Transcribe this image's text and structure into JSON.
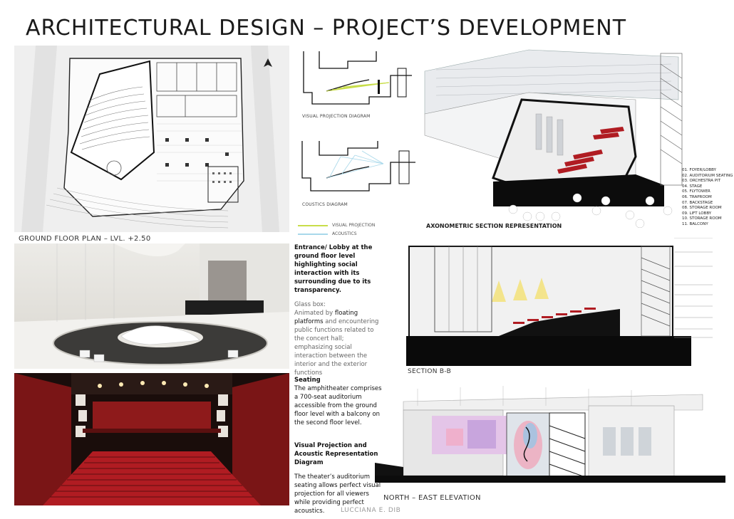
{
  "title": "ARCHITECTURAL DESIGN – PROJECT’S DEVELOPMENT",
  "plan": {
    "caption": "GROUND FLOOR PLAN – LVL. +2.50"
  },
  "diagrams": {
    "visual_caption": "VISUAL PROJECTION DIAGRAM",
    "acoustics_caption": "COUSTICS DIAGRAM",
    "legend": [
      {
        "label": "VISUAL PROJECTION",
        "color": "#c8dd4a"
      },
      {
        "label": "ACOUSTICS",
        "color": "#a8d8ea"
      }
    ]
  },
  "axonometric": {
    "caption": "AXONOMETRIC SECTION REPRESENTATION",
    "legend_items": [
      "01. FOYER/LOBBY",
      "02. AUDITORIUM SEATING",
      "03. ORCHESTRA PIT",
      "04. STAGE",
      "05. FLYTOWER",
      "06. TRAPROOM",
      "07. BACKSTAGE",
      "08. STORAGE ROOM",
      "09. LIFT LOBBY",
      "10. STORAGE ROOM",
      "11. BALCONY"
    ]
  },
  "lobby": {
    "heading": "Entrance/ Lobby at the ground floor level highlighting social interaction with its surrounding due to its transparency.",
    "sub_heading": "Glass box:",
    "body_pre": "Animated by ",
    "body_hl1": "floating platforms",
    "body_mid": "and encountering public functions related to the concert hall; emphasizing social interaction between the interior and the exterior functions"
  },
  "seating": {
    "heading": "Seating",
    "body": "The amphitheater comprises a 700-seat auditorium accessible from the ground floor level with a balcony on the second floor level."
  },
  "projection": {
    "heading": "Visual Projection and Acoustic Representation Diagram",
    "body": "The theater’s auditorium seating allows perfect visual projection for all viewers while providing perfect acoustics."
  },
  "section": {
    "caption": "SECTION B-B"
  },
  "elevation": {
    "caption": "NORTH – EAST ELEVATION"
  },
  "author": "LUCCIANA E. DIB",
  "colors": {
    "seat_red": "#b01c22",
    "dark": "#111111"
  }
}
